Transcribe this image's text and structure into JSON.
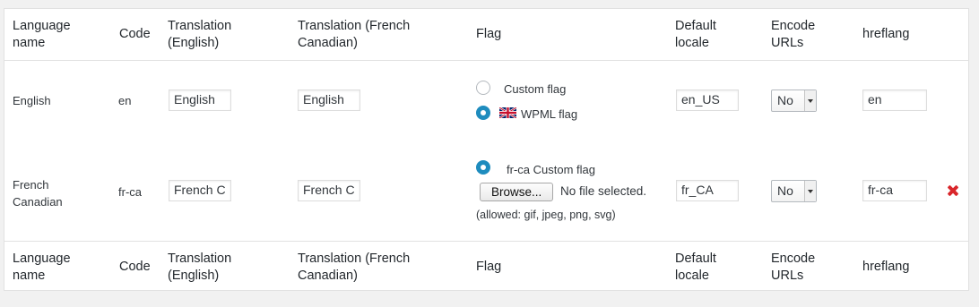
{
  "columns": {
    "language_name": "Language\nname",
    "code": "Code",
    "translation_english": "Translation\n(English)",
    "translation_french_canadian": "Translation (French\nCanadian)",
    "flag": "Flag",
    "default_locale": "Default\nlocale",
    "encode_urls": "Encode\nURLs",
    "hreflang": "hreflang"
  },
  "rows": [
    {
      "language_name": "English",
      "code": "en",
      "translation_english": "English",
      "translation_french_canadian": "English",
      "flag_option_custom": "Custom flag",
      "flag_option_wpml": "WPML flag",
      "flag_selected": "wpml",
      "default_locale": "en_US",
      "encode_urls": "No",
      "hreflang": "en"
    },
    {
      "language_name": "French\nCanadian",
      "code": "fr-ca",
      "translation_english": "French C",
      "translation_french_canadian": "French C",
      "flag_option_custom": "fr-ca Custom flag",
      "browse_button": "Browse...",
      "file_status": "No file selected.",
      "allowed_types": "(allowed: gif, jpeg, png, svg)",
      "flag_selected": "custom",
      "default_locale": "fr_CA",
      "encode_urls": "No",
      "hreflang": "fr-ca",
      "delete_icon": "delete-icon"
    }
  ],
  "colors": {
    "radio_checked": "#1e8cbe",
    "delete_icon": "#d9262b"
  }
}
